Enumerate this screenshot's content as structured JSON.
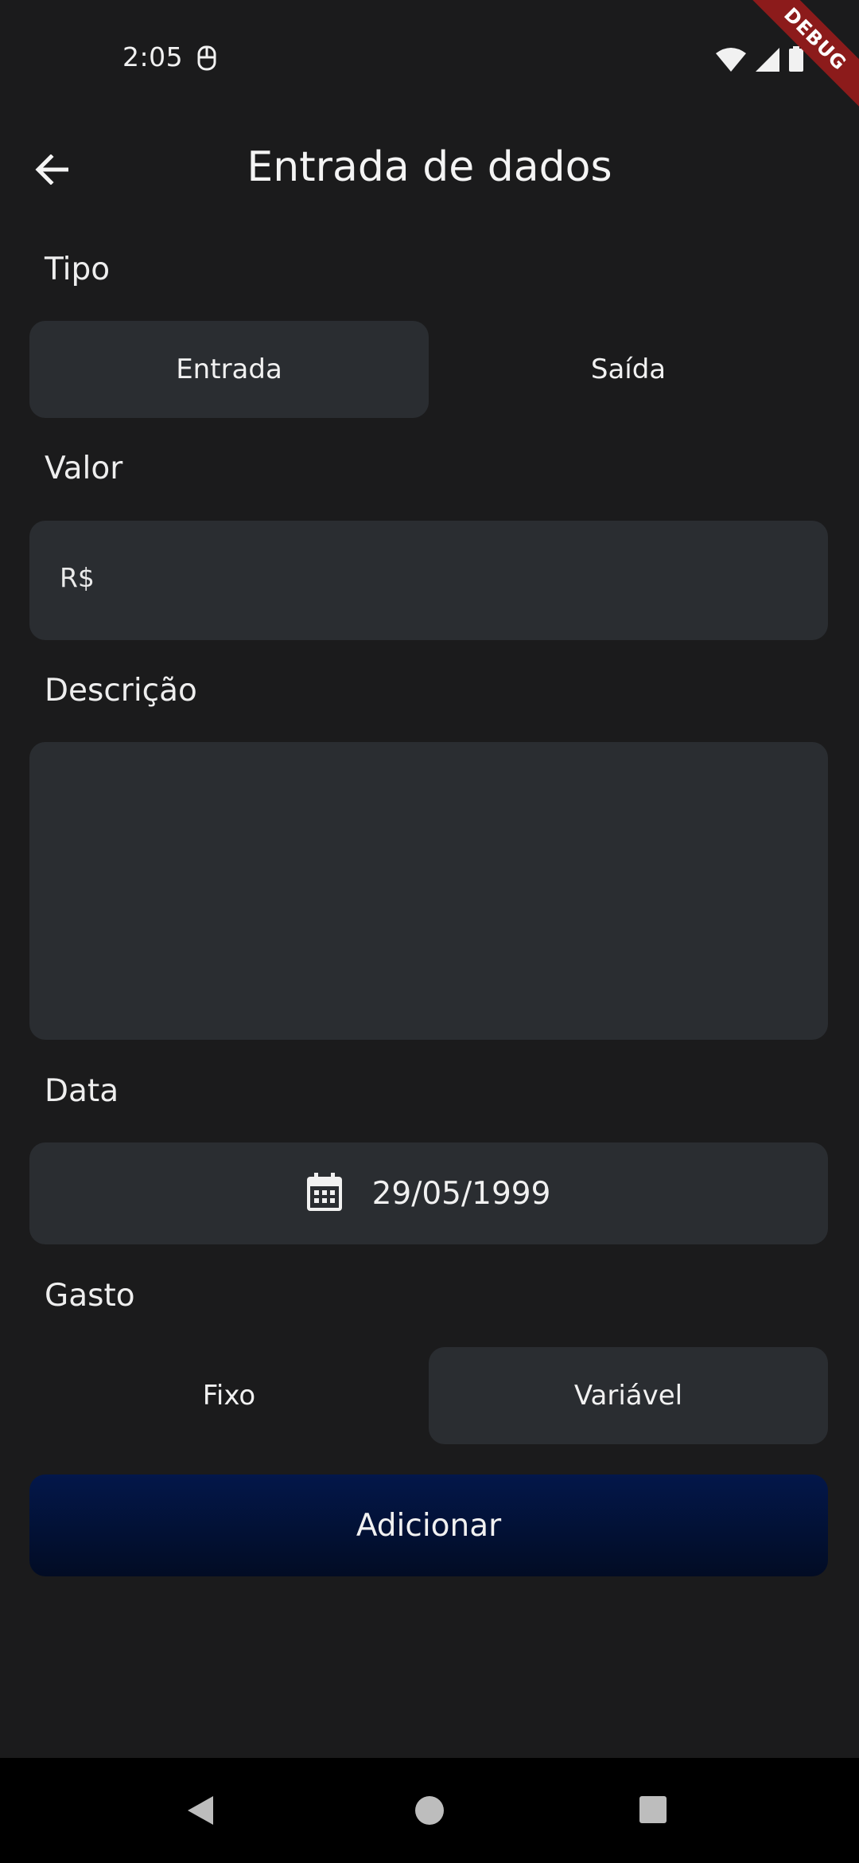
{
  "status_bar": {
    "time": "2:05",
    "debug_label": "DEBUG"
  },
  "header": {
    "title": "Entrada de dados"
  },
  "form": {
    "tipo": {
      "label": "Tipo",
      "options": [
        "Entrada",
        "Saída"
      ],
      "selected": "Entrada"
    },
    "valor": {
      "label": "Valor",
      "prefix": "R$",
      "value": ""
    },
    "descricao": {
      "label": "Descrição",
      "value": ""
    },
    "data": {
      "label": "Data",
      "value": "29/05/1999"
    },
    "gasto": {
      "label": "Gasto",
      "options": [
        "Fixo",
        "Variável"
      ],
      "selected": "Variável"
    },
    "submit_label": "Adicionar"
  },
  "colors": {
    "background": "#1b1b1c",
    "field": "#2a2d31",
    "button_top": "#03174a",
    "button_bottom": "#020c24",
    "debug_banner": "#8c1b1b"
  },
  "icons": {
    "back": "arrow-left-icon",
    "date": "calendar-icon",
    "nav": [
      "back-triangle-icon",
      "home-circle-icon",
      "recents-square-icon"
    ]
  }
}
